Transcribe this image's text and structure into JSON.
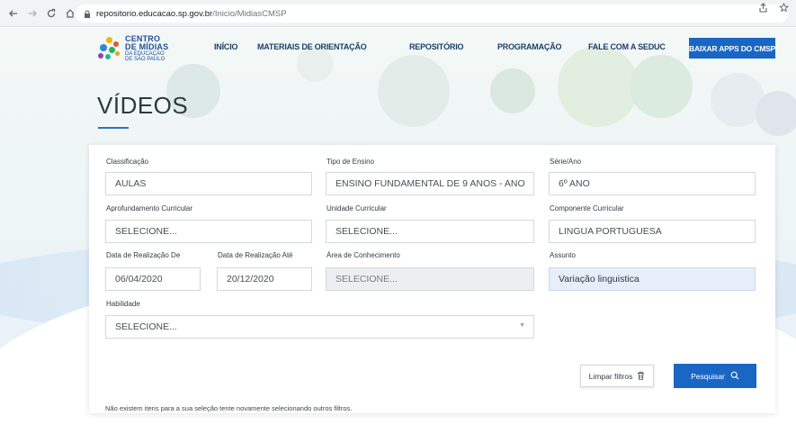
{
  "browser": {
    "url_host": "repositorio.educacao.sp.gov.br",
    "url_path": "/Inicio/MidiasCMSP"
  },
  "header": {
    "logo": {
      "line1": "CENTRO",
      "line2": "DE MÍDIAS",
      "line3": "DA EDUCAÇÃO",
      "line4": "DE SÃO PAULO"
    },
    "menu": [
      {
        "label": "INÍCIO"
      },
      {
        "label": "MATERIAIS DE ORIENTAÇÃO"
      },
      {
        "label": "REPOSITÓRIO"
      },
      {
        "label": "PROGRAMAÇÃO"
      },
      {
        "label": "FALE COM A SEDUC"
      }
    ],
    "apps_button": "BAIXAR APPS DO CMSP"
  },
  "page": {
    "title": "VÍDEOS"
  },
  "filters": {
    "classificacao": {
      "label": "Classificação",
      "value": "AULAS"
    },
    "tipo_ensino": {
      "label": "Tipo de Ensino",
      "value": "ENSINO FUNDAMENTAL DE 9 ANOS - ANO"
    },
    "serie_ano": {
      "label": "Série/Ano",
      "value": "6º ANO"
    },
    "aprofundamento": {
      "label": "Aprofundamento Curricular",
      "value": "SELECIONE..."
    },
    "unidade": {
      "label": "Unidade Curricular",
      "value": "SELECIONE..."
    },
    "componente": {
      "label": "Componente Curricular",
      "value": "LINGUA PORTUGUESA"
    },
    "data_de": {
      "label": "Data de Realização De",
      "value": "06/04/2020"
    },
    "data_ate": {
      "label": "Data de Realização Até",
      "value": "20/12/2020"
    },
    "area": {
      "label": "Área de Conhecimento",
      "value": "SELECIONE..."
    },
    "assunto": {
      "label": "Assunto",
      "value": "Variação linguistica"
    },
    "habilidade": {
      "label": "Habilidade",
      "value": "SELECIONE..."
    }
  },
  "actions": {
    "clear": "Limpar filtros",
    "search": "Pesquisar"
  },
  "results": {
    "message": "Não existem itens para a sua seleção tente novamente selecionando outros filtros."
  },
  "colors": {
    "primary": "#1a66c4",
    "title": "#2d3a45",
    "nav": "#1e3e6e"
  },
  "icons": {
    "back": "arrow-left-icon",
    "forward": "arrow-right-icon",
    "reload": "reload-icon",
    "home": "home-icon",
    "lock": "lock-icon",
    "share": "share-icon",
    "bookmark": "star-icon",
    "trash": "trash-icon",
    "search": "search-icon",
    "dropdown": "caret-down-icon"
  }
}
